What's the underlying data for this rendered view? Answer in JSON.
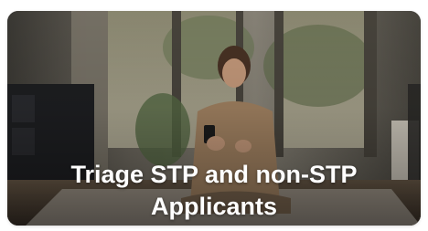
{
  "card": {
    "title_line1": "Triage STP and non-STP",
    "title_line2": "Applicants",
    "image_subject": "woman-using-smartphone-photo"
  }
}
